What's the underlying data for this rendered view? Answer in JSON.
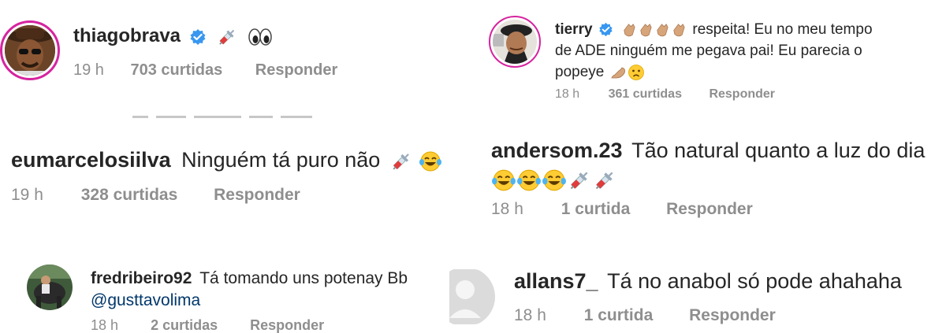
{
  "comments": [
    {
      "username": "thiagobrava",
      "verified": true,
      "text": "",
      "emojis": [
        "syringe",
        "eyes"
      ],
      "time": "19 h",
      "likes": "703 curtidas",
      "reply": "Responder"
    },
    {
      "username": "eumarcelosiilva",
      "verified": false,
      "text": "Ninguém tá puro não",
      "emojis": [
        "syringe",
        "laughing-tears"
      ],
      "time": "19 h",
      "likes": "328 curtidas",
      "reply": "Responder"
    },
    {
      "username": "fredribeiro92",
      "verified": false,
      "text": "Tá tomando uns potenay Bb",
      "mention": "@gusttavolima",
      "time": "18 h",
      "likes": "2 curtidas",
      "reply": "Responder"
    },
    {
      "username": "tierry",
      "verified": true,
      "text_line1": "respeita! Eu no meu tempo",
      "text_line2": "de ADE ninguém me pegava pai! Eu parecia o",
      "text_line3": "popeye",
      "emojis_before": [
        "clap",
        "clap",
        "clap",
        "clap"
      ],
      "emojis_after": [
        "flexed-biceps",
        "worried-face"
      ],
      "time": "18 h",
      "likes": "361 curtidas",
      "reply": "Responder"
    },
    {
      "username": "andersom.23",
      "verified": false,
      "text": "Tão natural quanto a luz do dia",
      "emojis": [
        "laughing-tears",
        "laughing-tears",
        "laughing-tears",
        "syringe",
        "syringe"
      ],
      "time": "18 h",
      "likes": "1 curtida",
      "reply": "Responder"
    },
    {
      "username": "allans7_",
      "verified": false,
      "text": "Tá no anabol só pode ahahaha",
      "time": "18 h",
      "likes": "1 curtida",
      "reply": "Responder"
    }
  ],
  "colors": {
    "text": "#262626",
    "meta": "#8e8e8e",
    "verified": "#3897f0",
    "mention": "#00376b",
    "story_ring": "#d6249f"
  }
}
